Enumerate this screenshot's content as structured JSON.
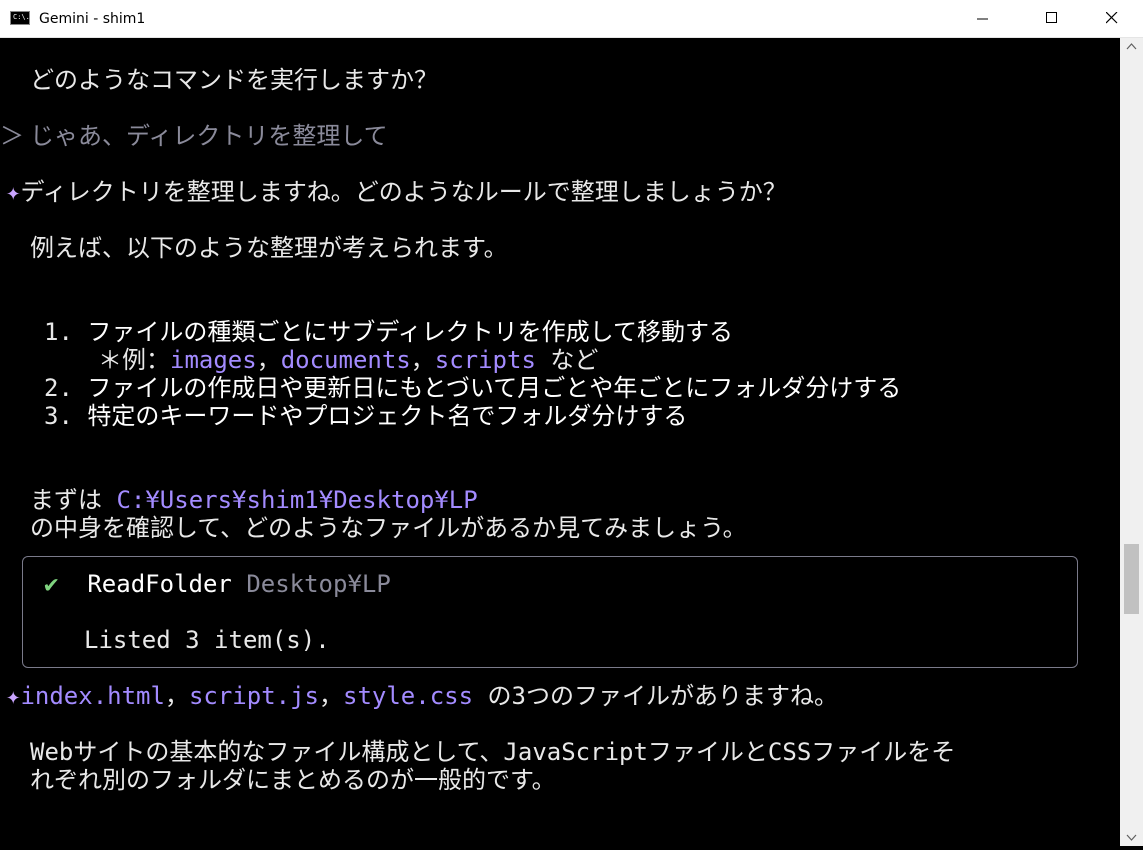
{
  "window": {
    "title": "Gemini - shim1",
    "icon_name": "console-icon",
    "icon_text": "C:\\."
  },
  "terminal": {
    "q1": "どのようなコマンドを実行しますか？",
    "prompt_marker": "＞",
    "user_input": "じゃあ、ディレクトリを整理して",
    "star": "✦",
    "reply1": "ディレクトリを整理しますね。どのようなルールで整理しましょうか？",
    "example_intro": "例えば、以下のような整理が考えられます。",
    "list": [
      {
        "num": "1.",
        "text": "ファイルの種類ごとにサブディレクトリを作成して移動する"
      },
      {
        "num": "2.",
        "text": "ファイルの作成日や更新日にもとづいて月ごとや年ごとにフォルダ分けする"
      },
      {
        "num": "3.",
        "text": "特定のキーワードやプロジェクト名でフォルダ分けする"
      }
    ],
    "sub_bullet": "＊",
    "sub_prefix": "例：",
    "sub_items": [
      "images",
      "documents",
      "scripts"
    ],
    "sub_sep": "，",
    "sub_suffix": "など",
    "check_prefix": "まずは",
    "path": "C:¥Users¥shim1¥Desktop¥LP",
    "check_suffix": "の中身を確認して、どのようなファイルがあるか見てみましょう。",
    "tool": {
      "check": "✔",
      "name": "ReadFolder",
      "arg": "Desktop¥LP",
      "result": "Listed 3 item(s)."
    },
    "files": [
      "index.html",
      "script.js",
      "style.css"
    ],
    "files_suffix": "の3つのファイルがありますね。",
    "advice_line1": "Webサイトの基本的なファイル構成として、JavaScriptファイルとCSSファイルをそ",
    "advice_line2": "れぞれ別のフォルダにまとめるのが一般的です。"
  },
  "colors": {
    "background": "#000000",
    "text": "#e8e8e8",
    "dim": "#8a8a9a",
    "accent_purple": "#c9a4ff",
    "accent_blue": "#a38bff",
    "check_green": "#7fd37f"
  }
}
